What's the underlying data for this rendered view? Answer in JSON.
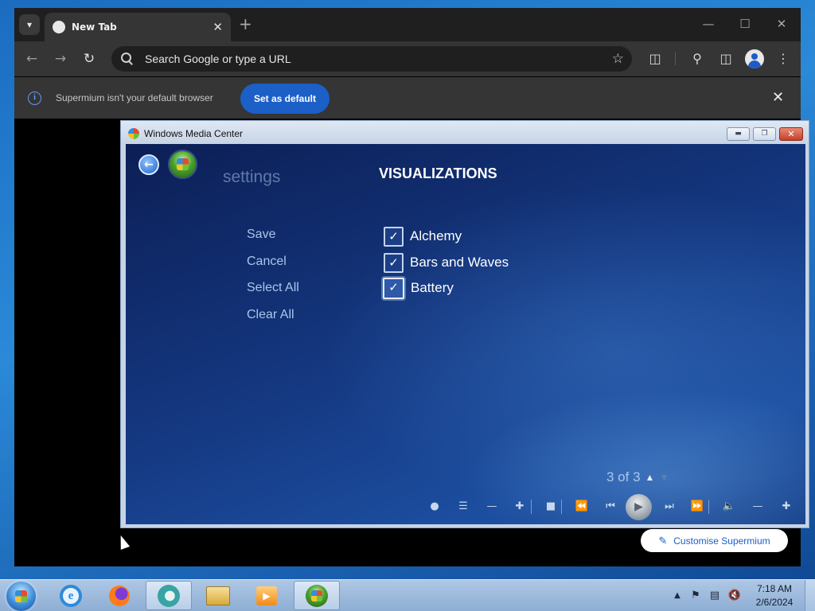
{
  "browser": {
    "tab_title": "New Tab",
    "new_tab_symbol": "+",
    "omnibox_placeholder": "Search Google or type a URL",
    "infobar": {
      "message": "Supermium isn't your default browser",
      "button_label": "Set as default"
    },
    "customise_label": "Customise Supermium"
  },
  "media_center": {
    "window_title": "Windows Media Center",
    "breadcrumb": "settings",
    "heading": "VISUALIZATIONS",
    "actions": [
      "Save",
      "Cancel",
      "Select All",
      "Clear All"
    ],
    "options": [
      {
        "label": "Alchemy",
        "checked": true
      },
      {
        "label": "Bars and Waves",
        "checked": true
      },
      {
        "label": "Battery",
        "checked": true
      }
    ],
    "pager": "3 of 3"
  },
  "taskbar": {
    "time": "7:18 AM",
    "date": "2/6/2024",
    "apps": [
      "internet-explorer",
      "firefox",
      "supermium",
      "windows-explorer",
      "media-player",
      "windows-media-center"
    ]
  },
  "icons": [
    "tab-search-icon",
    "back-icon",
    "forward-icon",
    "reload-icon",
    "search-icon",
    "star-icon",
    "extensions-icon",
    "labs-icon",
    "side-panel-icon",
    "profile-icon",
    "menu-icon",
    "info-icon",
    "pencil-icon",
    "record-icon",
    "playlist-icon",
    "volume-icon"
  ],
  "colors": {
    "chrome_dark": "#1f1f1f",
    "infobar_button": "#1b5fc7",
    "wmc_background": "#14367e",
    "wmc_accent_text": "#a9c6ec"
  }
}
